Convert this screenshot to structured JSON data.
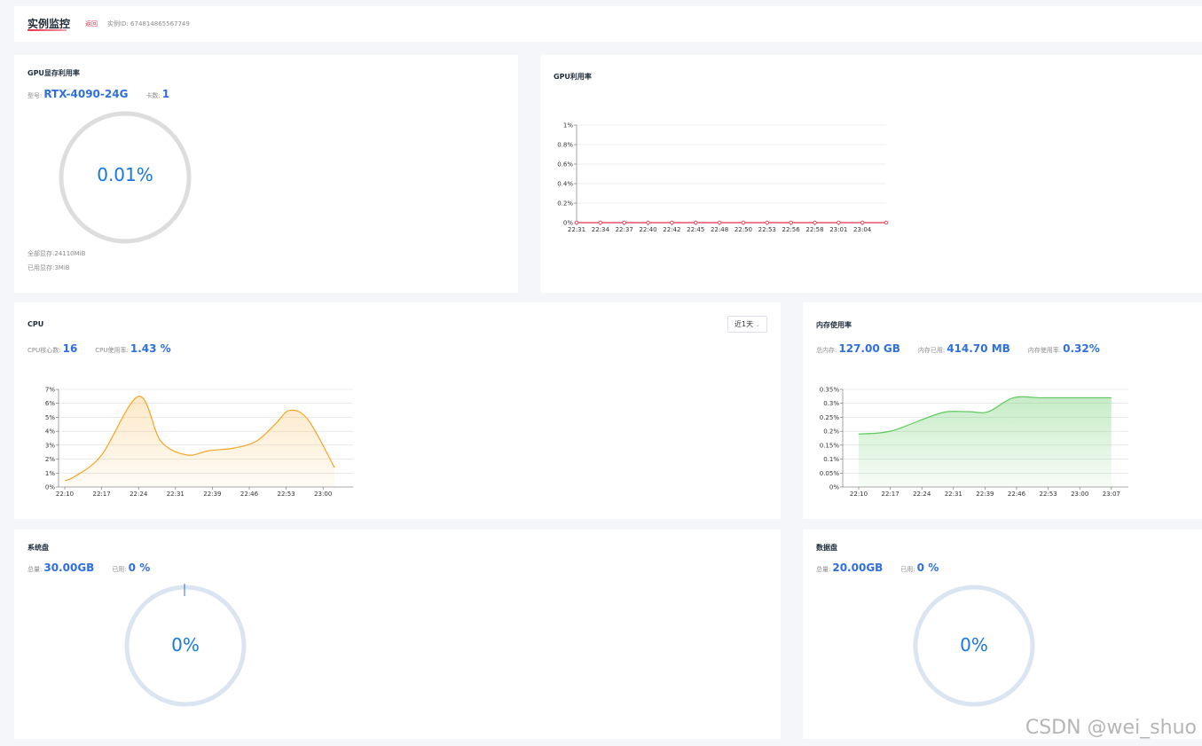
{
  "header": {
    "title": "实例监控",
    "back_label": "返回",
    "instance_id_label": "实例ID: 674814865567749"
  },
  "gpu_memory": {
    "title": "GPU显存利用率",
    "model_label": "型号:",
    "model_value": "RTX-4090-24G",
    "cards_label": "卡数:",
    "cards_value": "1",
    "percent": "0.01%",
    "percent_value": 0.01,
    "total_mem": "全部显存:24110MiB",
    "used_mem": "已用显存:3MiB"
  },
  "gpu_util": {
    "title": "GPU利用率"
  },
  "cpu": {
    "title": "CPU",
    "cores_label": "CPU核心数:",
    "cores_value": "16",
    "usage_label": "CPU使用率:",
    "usage_value": "1.43 %",
    "range_label": "近1天"
  },
  "memory": {
    "title": "内存使用率",
    "total_label": "总内存:",
    "total_value": "127.00 GB",
    "used_label": "内存已用:",
    "used_value": "414.70 MB",
    "rate_label": "内存使用率:",
    "rate_value": "0.32%"
  },
  "system_disk": {
    "title": "系统盘",
    "total_label": "总量:",
    "total_value": "30.00GB",
    "used_label": "已用:",
    "used_value": "0 %",
    "percent": "0%",
    "percent_value": 0
  },
  "data_disk": {
    "title": "数据盘",
    "total_label": "总量:",
    "total_value": "20.00GB",
    "used_label": "已用:",
    "used_value": "0 %",
    "percent": "0%",
    "percent_value": 0
  },
  "watermark": "CSDN @wei_shuo",
  "colors": {
    "accent": "#2f6fe0",
    "ring_text": "#1677e6",
    "gpu_line": "#e8304a",
    "cpu_line": "#f5a623",
    "mem_line": "#5cc85c",
    "ring_gpu": "#dddddd",
    "ring_disk": "#dbe5f1"
  },
  "chart_data": [
    {
      "type": "line",
      "title": "GPU利用率",
      "categories": [
        "22:31",
        "22:34",
        "22:37",
        "22:40",
        "22:42",
        "22:45",
        "22:48",
        "22:50",
        "22:53",
        "22:56",
        "22:58",
        "23:01",
        "23:04"
      ],
      "series": [
        {
          "values": [
            0,
            0,
            0,
            0,
            0,
            0,
            0,
            0,
            0,
            0,
            0,
            0,
            0,
            0
          ]
        }
      ],
      "ylim": [
        0,
        1
      ],
      "yticks": [
        "0%",
        "0.2%",
        "0.4%",
        "0.6%",
        "0.8%",
        "1%"
      ],
      "grid": true
    },
    {
      "type": "area",
      "title": "CPU",
      "categories": [
        "22:10",
        "22:17",
        "22:24",
        "22:31",
        "22:39",
        "22:46",
        "22:53",
        "23:00"
      ],
      "x": [
        0,
        0.5,
        1,
        1.5,
        2,
        2.5,
        3,
        3.5,
        4,
        4.5,
        5,
        5.5,
        6,
        6.5,
        7
      ],
      "series": [
        {
          "values": [
            0.45,
            0.8,
            2.3,
            6.5,
            3.3,
            2.3,
            2.6,
            2.8,
            3.3,
            4.5,
            5.5,
            4.8,
            1.4
          ]
        }
      ],
      "ylim": [
        0,
        7
      ],
      "yticks": [
        "0%",
        "1%",
        "2%",
        "3%",
        "4%",
        "5%",
        "6%",
        "7%"
      ],
      "grid": true
    },
    {
      "type": "area",
      "title": "内存使用率",
      "categories": [
        "22:10",
        "22:17",
        "22:24",
        "22:31",
        "22:39",
        "22:46",
        "22:53",
        "23:00",
        "23:07"
      ],
      "series": [
        {
          "values": [
            0.19,
            0.2,
            0.25,
            0.27,
            0.27,
            0.27,
            0.32,
            0.32,
            0.32,
            0.32
          ]
        }
      ],
      "ylim": [
        0,
        0.35
      ],
      "yticks": [
        "0%",
        "0.05%",
        "0.1%",
        "0.15%",
        "0.2%",
        "0.25%",
        "0.3%",
        "0.35%"
      ],
      "grid": true
    }
  ]
}
